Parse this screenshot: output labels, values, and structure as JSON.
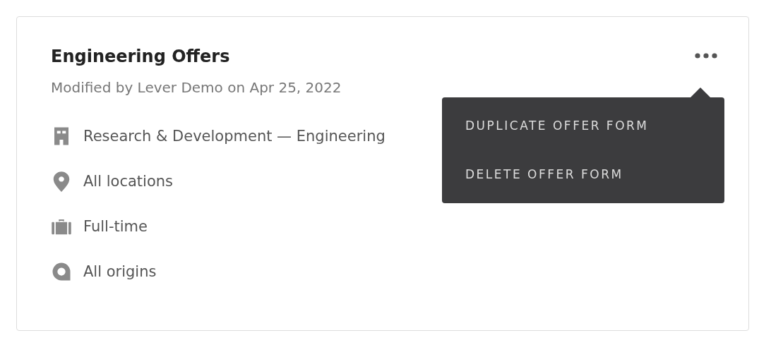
{
  "card": {
    "title": "Engineering Offers",
    "subtitle": "Modified by Lever Demo on Apr 25, 2022",
    "details": [
      {
        "kind": "department",
        "text": "Research & Development — Engineering"
      },
      {
        "kind": "location",
        "text": "All locations"
      },
      {
        "kind": "commitment",
        "text": "Full-time"
      },
      {
        "kind": "origin",
        "text": "All origins"
      }
    ]
  },
  "menu": {
    "open": true,
    "items": [
      "DUPLICATE OFFER FORM",
      "DELETE OFFER FORM"
    ]
  }
}
